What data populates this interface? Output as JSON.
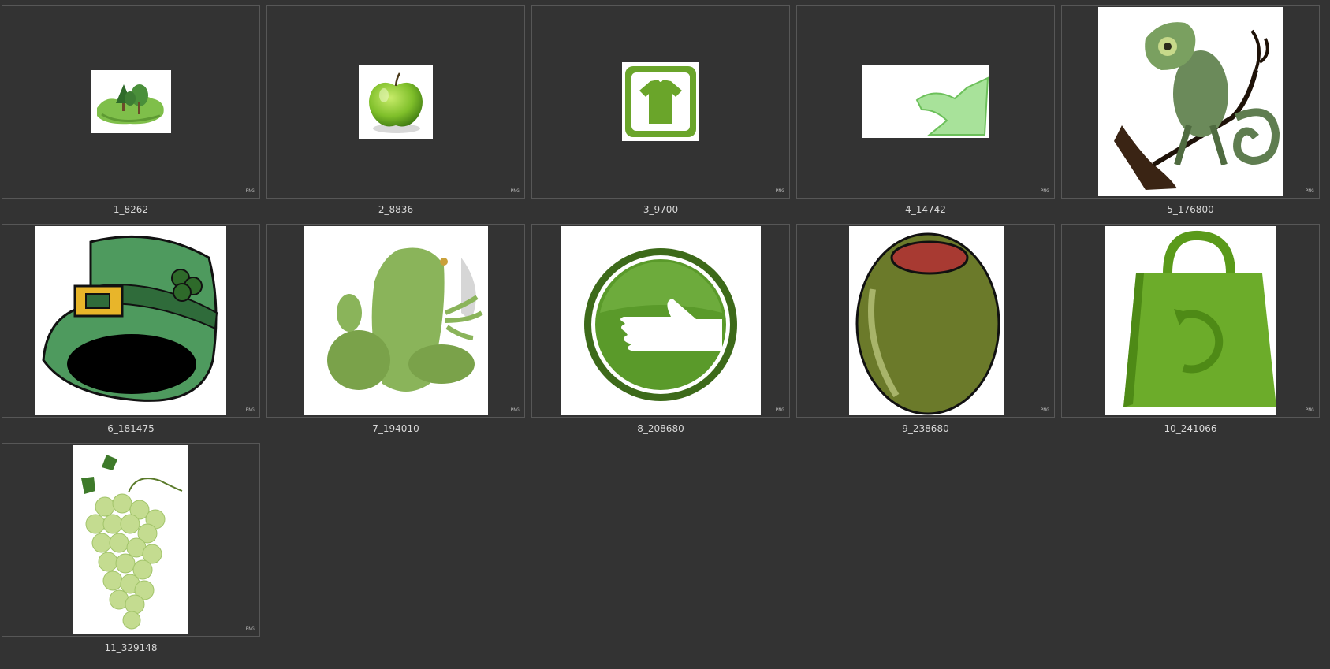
{
  "items": [
    {
      "filename": "1_8262",
      "badge": "PNG",
      "icon": "trees-island-icon"
    },
    {
      "filename": "2_8836",
      "badge": "PNG",
      "icon": "green-apple-icon"
    },
    {
      "filename": "3_9700",
      "badge": "PNG",
      "icon": "tshirt-sign-icon"
    },
    {
      "filename": "4_14742",
      "badge": "PNG",
      "icon": "redo-arrow-icon"
    },
    {
      "filename": "5_176800",
      "badge": "PNG",
      "icon": "chameleon-icon"
    },
    {
      "filename": "6_181475",
      "badge": "PNG",
      "icon": "leprechaun-hat-icon"
    },
    {
      "filename": "7_194010",
      "badge": "PNG",
      "icon": "frog-icon"
    },
    {
      "filename": "8_208680",
      "badge": "PNG",
      "icon": "hand-button-icon"
    },
    {
      "filename": "9_238680",
      "badge": "PNG",
      "icon": "olive-icon"
    },
    {
      "filename": "10_241066",
      "badge": "PNG",
      "icon": "recycle-bag-icon"
    },
    {
      "filename": "11_329148",
      "badge": "PNG",
      "icon": "grapes-icon"
    }
  ],
  "colors": {
    "background": "#333333",
    "frame_border": "#575757",
    "caption_text": "#d8d8d8",
    "accent_green": "#5a9a2a"
  }
}
